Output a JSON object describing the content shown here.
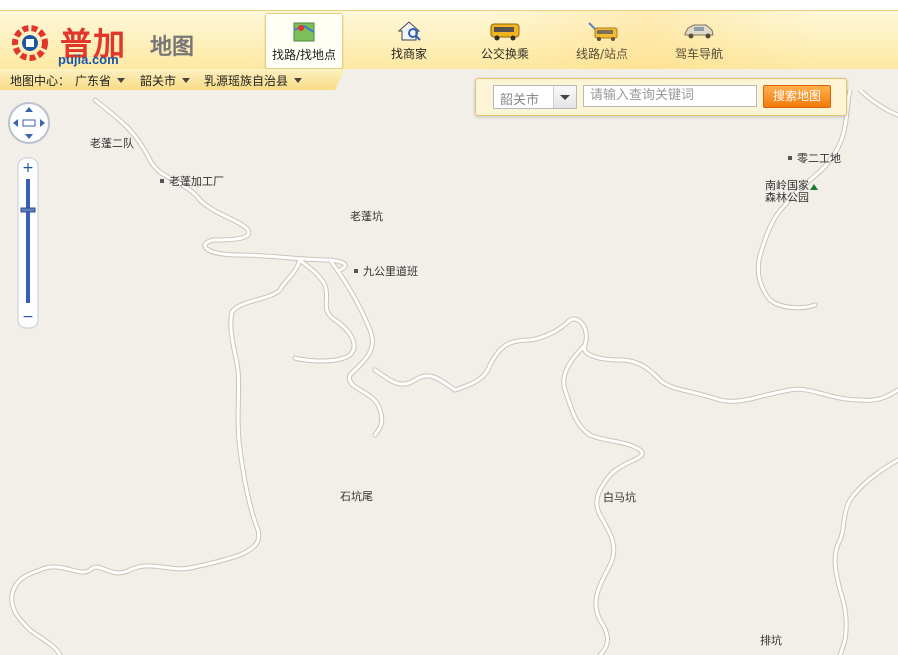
{
  "logo": {
    "cn": "普加",
    "en": "pujia.com",
    "sub": "地图"
  },
  "nav": [
    {
      "label": "找路/找地点",
      "icon": "map-folder-icon",
      "active": true
    },
    {
      "label": "找商家",
      "icon": "house-search-icon",
      "active": false
    },
    {
      "label": "公交换乘",
      "icon": "bus-icon",
      "active": false
    },
    {
      "label": "线路/站点",
      "icon": "bus-route-icon",
      "active": false
    },
    {
      "label": "驾车导航",
      "icon": "car-icon",
      "active": false
    }
  ],
  "center": {
    "label": "地图中心：",
    "province": "广东省",
    "city": "韶关市",
    "county": "乳源瑶族自治县"
  },
  "search": {
    "city": "韶关市",
    "placeholder": "请输入查询关键词",
    "button": "搜索地图"
  },
  "map_labels": {
    "l1": "老蓬二队",
    "l2": "老蓬加工厂",
    "l3": "老蓬坑",
    "l4": "九公里道班",
    "l5": "零二工地",
    "l6a": "南岭国家",
    "l6b": "森林公园",
    "l7": "石坑尾",
    "l8": "白马坑",
    "l9": "排坑"
  },
  "colors": {
    "map_bg": "#f2efe9",
    "road": "#ffffff",
    "accent": "#f27a0c",
    "logo_red": "#e0372a",
    "logo_blue": "#1b56a5"
  }
}
